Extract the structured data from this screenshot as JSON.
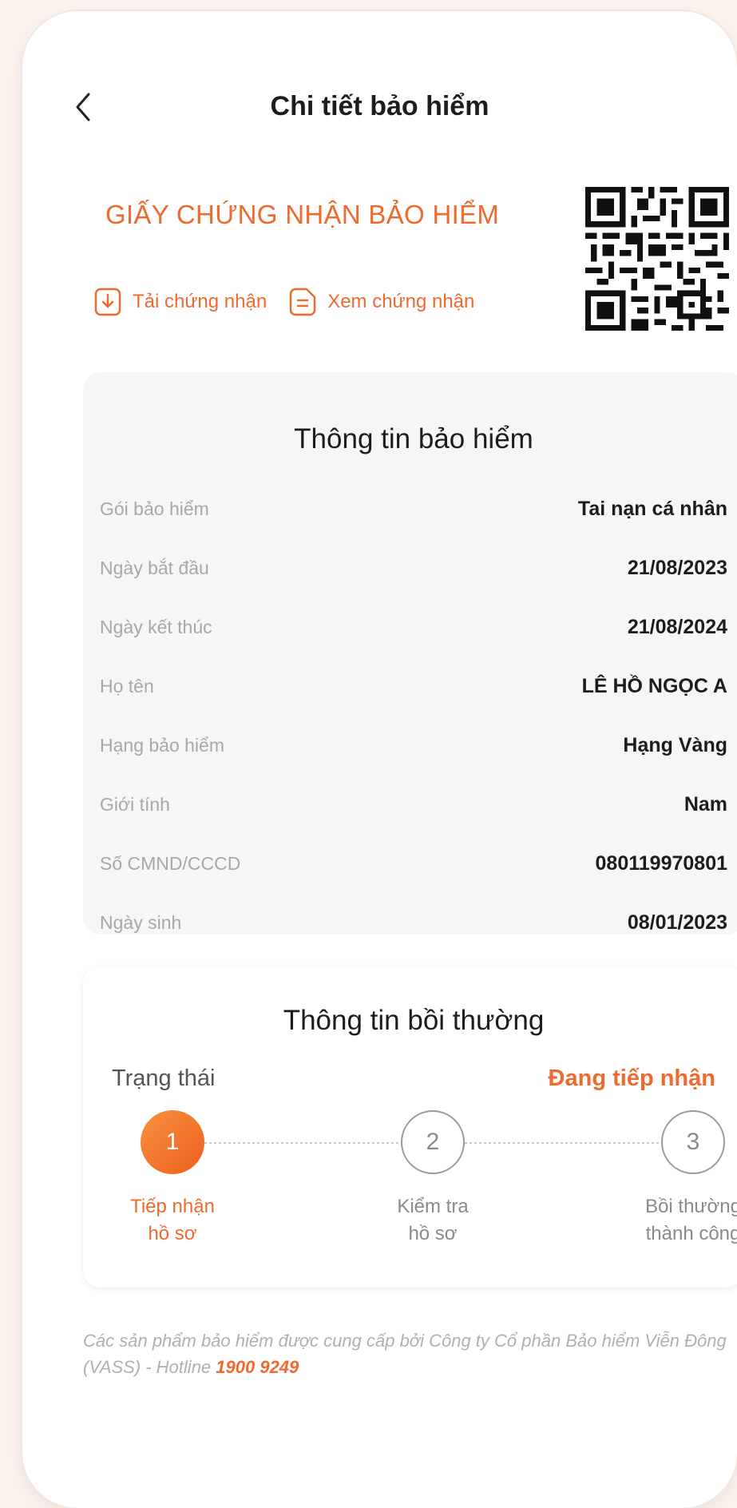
{
  "header": {
    "title": "Chi tiết bảo hiểm",
    "back_icon": "chevron-left-icon"
  },
  "certificate": {
    "title": "GIẤY CHỨNG NHẬN BẢO HIỂM",
    "download_label": "Tải chứng nhận",
    "view_label": "Xem chứng nhận",
    "qr_icon": "qr-code-icon"
  },
  "insurance_info": {
    "title": "Thông tin bảo hiểm",
    "rows": [
      {
        "label": "Gói bảo hiểm",
        "value": "Tai nạn cá nhân"
      },
      {
        "label": "Ngày bắt đầu",
        "value": "21/08/2023"
      },
      {
        "label": "Ngày kết thúc",
        "value": "21/08/2024"
      },
      {
        "label": "Họ tên",
        "value": "LÊ HỒ NGỌC A"
      },
      {
        "label": "Hạng bảo hiểm",
        "value": "Hạng Vàng"
      },
      {
        "label": "Giới tính",
        "value": "Nam"
      },
      {
        "label": "Số CMND/CCCD",
        "value": "080119970801"
      },
      {
        "label": "Ngày sinh",
        "value": "08/01/2023"
      }
    ]
  },
  "claim_info": {
    "title": "Thông tin bồi thường",
    "status_label": "Trạng thái",
    "status_value": "Đang tiếp nhận",
    "steps": [
      {
        "number": "1",
        "line1": "Tiếp nhận",
        "line2": "hồ sơ"
      },
      {
        "number": "2",
        "line1": "Kiểm tra",
        "line2": "hồ sơ"
      },
      {
        "number": "3",
        "line1": "Bồi thường",
        "line2": "thành công"
      }
    ]
  },
  "footer": {
    "text": "Các sản phẩm bảo hiểm được cung cấp bởi Công ty Cổ phần Bảo hiểm Viễn Đông (VASS) - Hotline ",
    "hotline": "1900 9249"
  },
  "colors": {
    "accent": "#ef6a2f",
    "card_bg": "#f6f6f6",
    "page_bg": "#fdf3ee"
  }
}
